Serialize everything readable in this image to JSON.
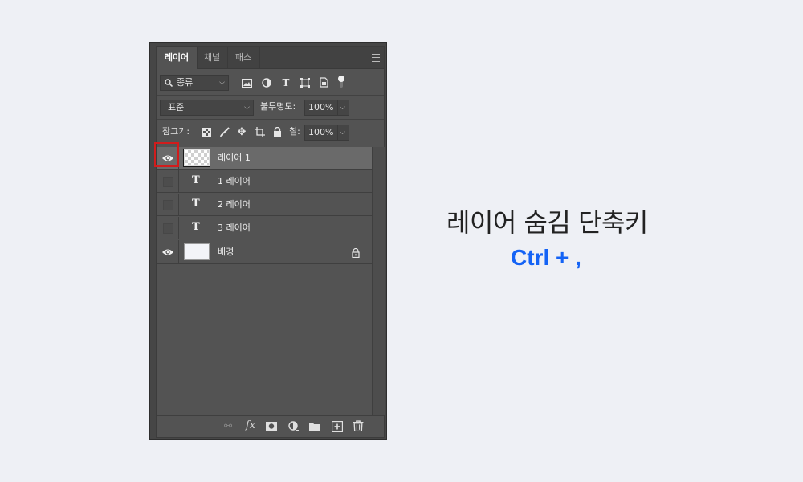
{
  "panel": {
    "tabs": [
      {
        "label": "레이어",
        "active": true
      },
      {
        "label": "채널",
        "active": false
      },
      {
        "label": "패스",
        "active": false
      }
    ],
    "filter": {
      "icon": "search-icon",
      "value": "종류"
    },
    "blend_mode": "표준",
    "opacity": {
      "label": "불투명도:",
      "value": "100%"
    },
    "lock": {
      "label": "잠그기:"
    },
    "fill": {
      "label": "칠:",
      "value": "100%"
    },
    "layers": [
      {
        "name": "레이어 1",
        "type": "raster",
        "visible": true,
        "selected": true
      },
      {
        "name": "1 레이어",
        "type": "text",
        "visible": false,
        "selected": false
      },
      {
        "name": "2 레이어",
        "type": "text",
        "visible": false,
        "selected": false
      },
      {
        "name": "3 레이어",
        "type": "text",
        "visible": false,
        "selected": false
      },
      {
        "name": "배경",
        "type": "background",
        "visible": true,
        "selected": false,
        "locked": true
      }
    ],
    "footer_icons": [
      "link-icon",
      "fx-icon",
      "mask-icon",
      "adjustment-icon",
      "folder-icon",
      "new-layer-icon",
      "trash-icon"
    ]
  },
  "heading": {
    "title": "레이어 숨김 단축키",
    "shortcut": "Ctrl + ,"
  },
  "colors": {
    "highlight": "#d11c1c",
    "accent": "#1463f5",
    "background": "#eef0f5"
  }
}
